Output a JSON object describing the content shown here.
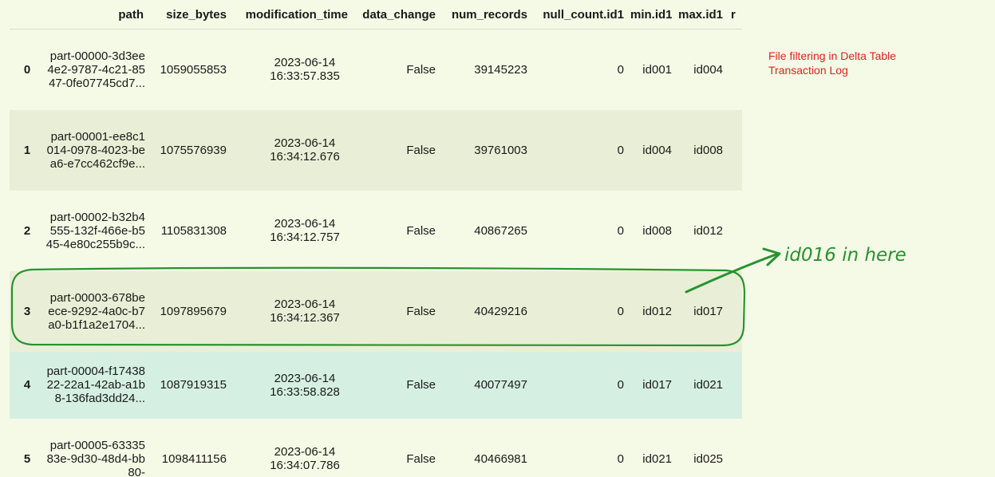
{
  "table": {
    "columns": [
      "",
      "path",
      "size_bytes",
      "modification_time",
      "data_change",
      "num_records",
      "null_count.id1",
      "min.id1",
      "max.id1",
      "r"
    ],
    "rows": [
      {
        "index": "0",
        "path": "part-00000-3d3ee4e2-9787-4c21-8547-0fe07745cd7...",
        "size_bytes": "1059055853",
        "modification_date": "2023-06-14",
        "modification_clock": "16:33:57.835",
        "data_change": "False",
        "num_records": "39145223",
        "null_count": "0",
        "min_id1": "id001",
        "max_id1": "id004"
      },
      {
        "index": "1",
        "path": "part-00001-ee8c1014-0978-4023-bea6-e7cc462cf9e...",
        "size_bytes": "1075576939",
        "modification_date": "2023-06-14",
        "modification_clock": "16:34:12.676",
        "data_change": "False",
        "num_records": "39761003",
        "null_count": "0",
        "min_id1": "id004",
        "max_id1": "id008"
      },
      {
        "index": "2",
        "path": "part-00002-b32b4555-132f-466e-b545-4e80c255b9c...",
        "size_bytes": "1105831308",
        "modification_date": "2023-06-14",
        "modification_clock": "16:34:12.757",
        "data_change": "False",
        "num_records": "40867265",
        "null_count": "0",
        "min_id1": "id008",
        "max_id1": "id012"
      },
      {
        "index": "3",
        "path": "part-00003-678beece-9292-4a0c-b7a0-b1f1a2e1704...",
        "size_bytes": "1097895679",
        "modification_date": "2023-06-14",
        "modification_clock": "16:34:12.367",
        "data_change": "False",
        "num_records": "40429216",
        "null_count": "0",
        "min_id1": "id012",
        "max_id1": "id017"
      },
      {
        "index": "4",
        "path": "part-00004-f1743822-22a1-42ab-a1b8-136fad3dd24...",
        "size_bytes": "1087919315",
        "modification_date": "2023-06-14",
        "modification_clock": "16:33:58.828",
        "data_change": "False",
        "num_records": "40077497",
        "null_count": "0",
        "min_id1": "id017",
        "max_id1": "id021"
      },
      {
        "index": "5",
        "path": "part-00005-6333583e-9d30-48d4-bb80-",
        "size_bytes": "1098411156",
        "modification_date": "2023-06-14",
        "modification_clock": "16:34:07.786",
        "data_change": "False",
        "num_records": "40466981",
        "null_count": "0",
        "min_id1": "id021",
        "max_id1": "id025"
      }
    ]
  },
  "annotation": {
    "line1": "File filtering in Delta Table",
    "line2": "Transaction Log"
  },
  "handwriting": {
    "text": "id016 in here",
    "color": "#27922f"
  },
  "colors": {
    "background": "#f5fae6",
    "striped_row": "#e9efd6",
    "hover_row": "#d5f0e3",
    "annotation_red": "#e3211c",
    "marker_green": "#27922f"
  }
}
